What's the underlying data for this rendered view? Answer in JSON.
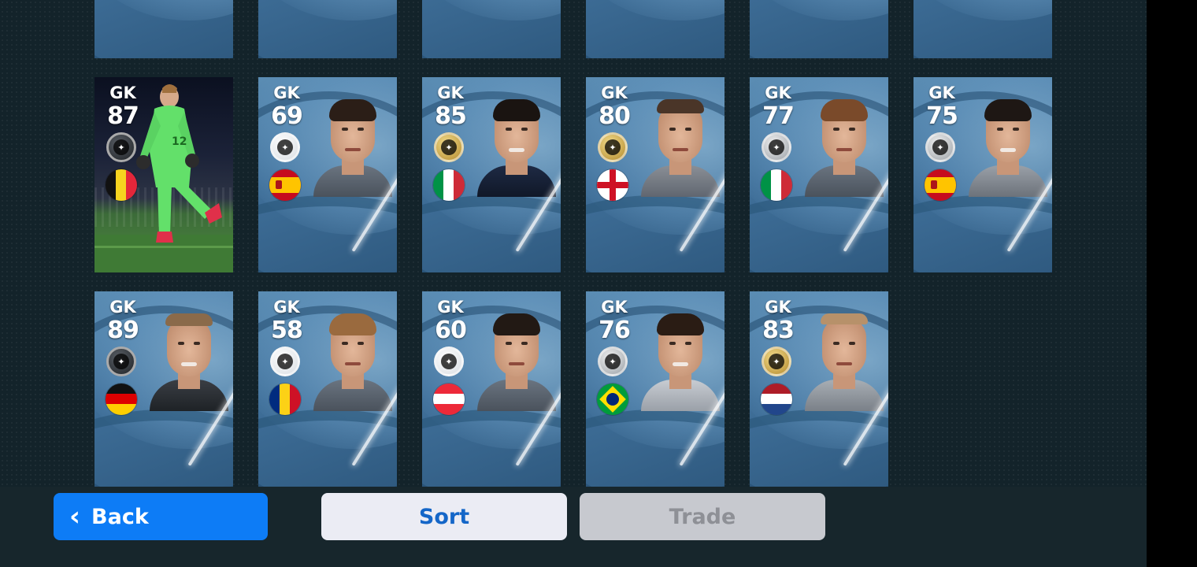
{
  "buttons": {
    "back_label": "Back",
    "sort_label": "Sort",
    "trade_label": "Trade"
  },
  "top_row_count": 6,
  "players": [
    {
      "position": "GK",
      "rating": "87",
      "medal": "black",
      "flag": "belgium",
      "portrait": "full-body-keeper"
    },
    {
      "position": "GK",
      "rating": "69",
      "medal": "white",
      "flag": "spain",
      "portrait": "face"
    },
    {
      "position": "GK",
      "rating": "85",
      "medal": "gold",
      "flag": "italy",
      "portrait": "face"
    },
    {
      "position": "GK",
      "rating": "80",
      "medal": "gold",
      "flag": "england",
      "portrait": "face"
    },
    {
      "position": "GK",
      "rating": "77",
      "medal": "silver",
      "flag": "italy",
      "portrait": "face"
    },
    {
      "position": "GK",
      "rating": "75",
      "medal": "silver",
      "flag": "spain",
      "portrait": "face"
    },
    {
      "position": "GK",
      "rating": "89",
      "medal": "black",
      "flag": "germany",
      "portrait": "face"
    },
    {
      "position": "GK",
      "rating": "58",
      "medal": "white",
      "flag": "romania",
      "portrait": "face"
    },
    {
      "position": "GK",
      "rating": "60",
      "medal": "white",
      "flag": "austria",
      "portrait": "face"
    },
    {
      "position": "GK",
      "rating": "76",
      "medal": "silver",
      "flag": "brazil",
      "portrait": "face"
    },
    {
      "position": "GK",
      "rating": "83",
      "medal": "gold",
      "flag": "netherlands",
      "portrait": "face"
    }
  ],
  "colors": {
    "back_button": "#0d7cf6",
    "sort_text": "#1466c8",
    "card_blue": "#3f6f99"
  }
}
